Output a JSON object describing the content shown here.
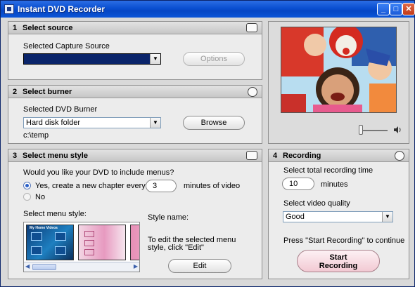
{
  "window": {
    "title": "Instant DVD Recorder"
  },
  "source": {
    "number": "1",
    "title": "Select source",
    "capture_label": "Selected Capture Source",
    "capture_value": "",
    "options_label": "Options"
  },
  "burner": {
    "number": "2",
    "title": "Select burner",
    "dvd_label": "Selected DVD Burner",
    "dvd_value": "Hard disk folder",
    "browse_label": "Browse",
    "path": "c:\\temp"
  },
  "menu": {
    "number": "3",
    "title": "Select menu style",
    "question": "Would you like your DVD to include menus?",
    "option_yes": "Yes, create a new chapter every",
    "chapter_minutes": "3",
    "minutes_suffix": "minutes of video",
    "option_no": "No",
    "menu_style_label": "Select menu style:",
    "style_name_label": "Style name:",
    "edit_hint": "To edit the selected menu style, click \"Edit\"",
    "edit_label": "Edit",
    "thumbnail_1_caption": "My Home Videos"
  },
  "recording": {
    "number": "4",
    "title": "Recording",
    "time_label": "Select total recording time",
    "time_value": "10",
    "time_unit": "minutes",
    "quality_label": "Select video quality",
    "quality_value": "Good",
    "hint": "Press \"Start Recording\" to continue",
    "start_line1": "Start",
    "start_line2": "Recording"
  },
  "colors": {
    "titlebar": "#0a4fd1",
    "selected_source": "#0a246a",
    "start_button": "#f2c9d3"
  }
}
